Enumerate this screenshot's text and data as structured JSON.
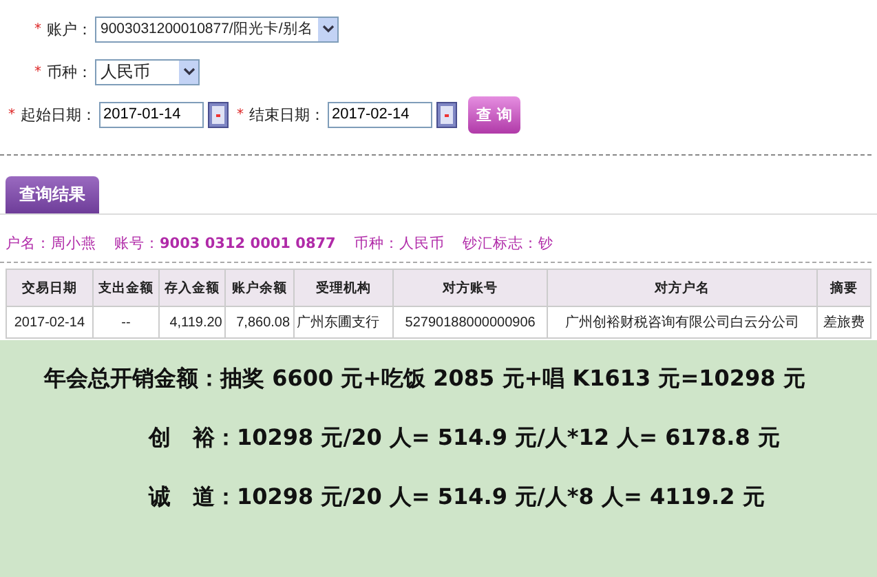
{
  "form": {
    "required_mark": "*",
    "account": {
      "label": "账户：",
      "value": "9003031200010877/阳光卡/别名"
    },
    "currency": {
      "label": "币种：",
      "value": "人民币"
    },
    "start_date": {
      "label": "起始日期：",
      "value": "2017-01-14"
    },
    "end_date": {
      "label": "结束日期：",
      "value": "2017-02-14"
    },
    "query_button": "查 询"
  },
  "tabs": [
    {
      "label": "查询结果",
      "selected": true
    }
  ],
  "info": [
    {
      "label": "户名：",
      "value": "周小燕"
    },
    {
      "label": "账号：",
      "value": "9003 0312 0001 0877"
    },
    {
      "label": "币种：",
      "value": "人民币"
    },
    {
      "label": "钞汇标志：",
      "value": "钞"
    }
  ],
  "table": {
    "columns": [
      "交易日期",
      "支出金额",
      "存入金额",
      "账户余额",
      "受理机构",
      "对方账号",
      "对方户名",
      "摘要"
    ],
    "rows": [
      [
        "2017-02-14",
        "--",
        "4,119.20",
        "7,860.08",
        "广州东圃支行",
        "52790188000000906",
        "广州创裕财税咨询有限公司白云分公司",
        "差旅费"
      ]
    ]
  },
  "note": {
    "lines": [
      "年会总开销金额：抽奖 6600 元+吃饭 2085 元+唱 K1613 元=10298 元",
      "创　裕：10298 元/20 人= 514.9 元/人*12 人= 6178.8 元",
      "诚　道：10298 元/20 人= 514.9 元/人*8 人= 4119.2 元"
    ]
  }
}
